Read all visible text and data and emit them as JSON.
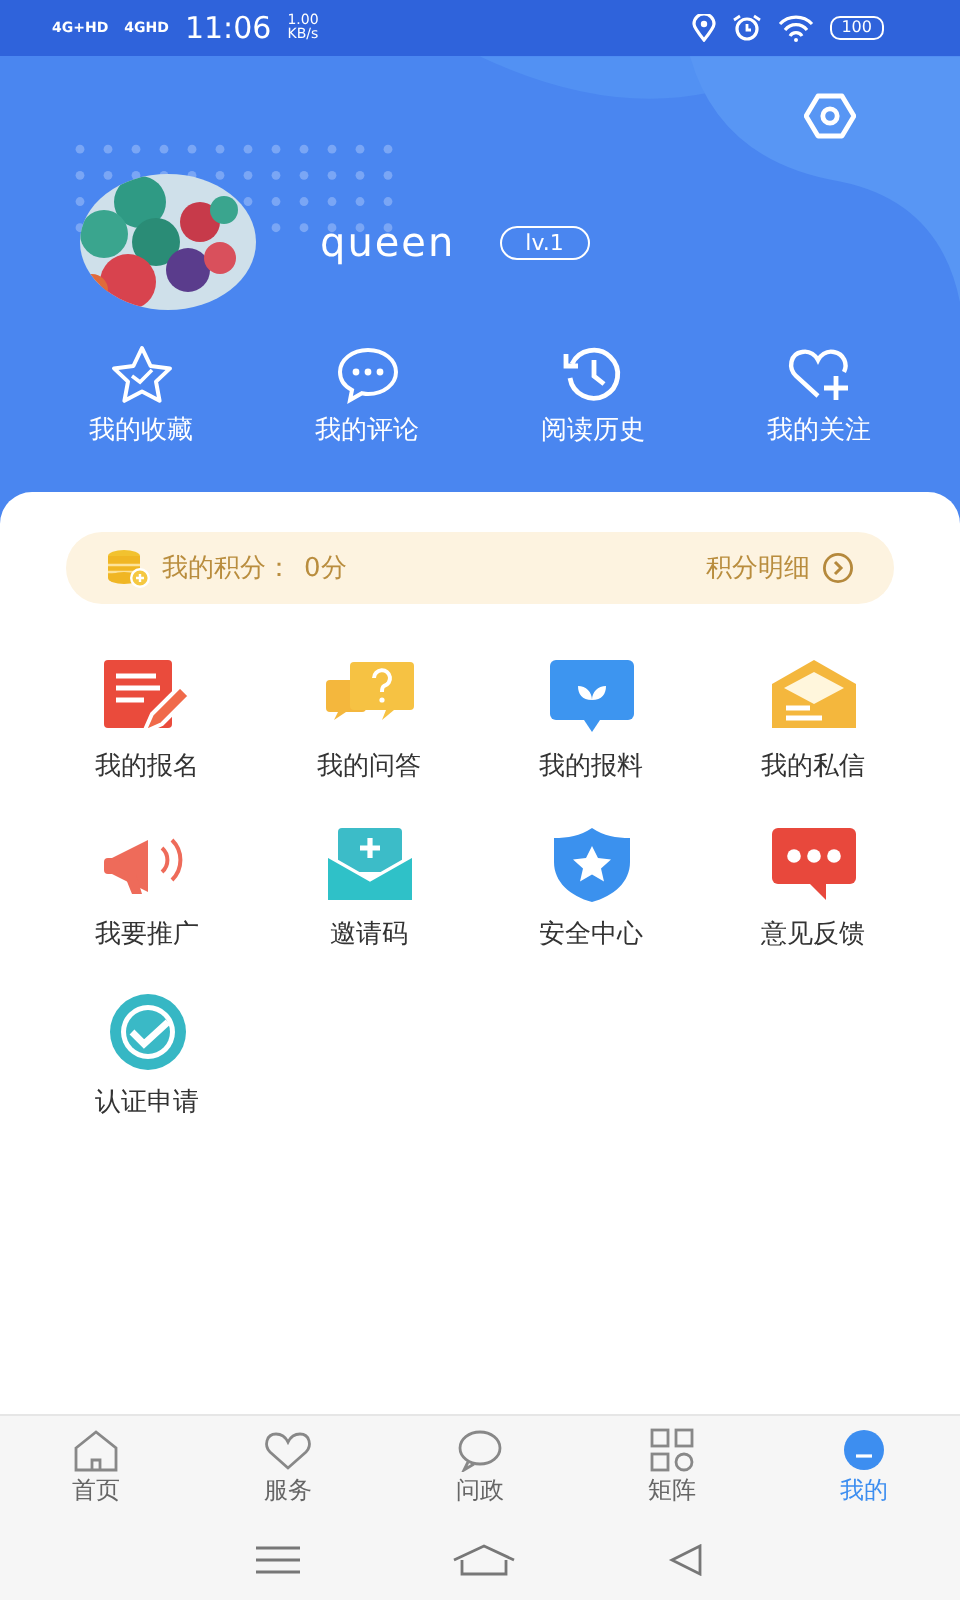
{
  "status_bar": {
    "network_1": "4G+HD",
    "network_2": "4GHD",
    "time": "11:06",
    "speed": "1.00",
    "speed_unit": "KB/s",
    "battery": "100"
  },
  "profile": {
    "name": "queen",
    "level_badge": "lv.1"
  },
  "shortcuts": [
    {
      "label": "我的收藏"
    },
    {
      "label": "我的评论"
    },
    {
      "label": "阅读历史"
    },
    {
      "label": "我的关注"
    }
  ],
  "points": {
    "label": "我的积分：",
    "value": "0分",
    "link": "积分明细"
  },
  "services": [
    {
      "label": "我的报名"
    },
    {
      "label": "我的问答"
    },
    {
      "label": "我的报料"
    },
    {
      "label": "我的私信"
    },
    {
      "label": "我要推广"
    },
    {
      "label": "邀请码"
    },
    {
      "label": "安全中心"
    },
    {
      "label": "意见反馈"
    },
    {
      "label": "认证申请"
    }
  ],
  "tabs": [
    {
      "label": "首页",
      "selected": false
    },
    {
      "label": "服务",
      "selected": false
    },
    {
      "label": "问政",
      "selected": false
    },
    {
      "label": "矩阵",
      "selected": false
    },
    {
      "label": "我的",
      "selected": true
    }
  ]
}
